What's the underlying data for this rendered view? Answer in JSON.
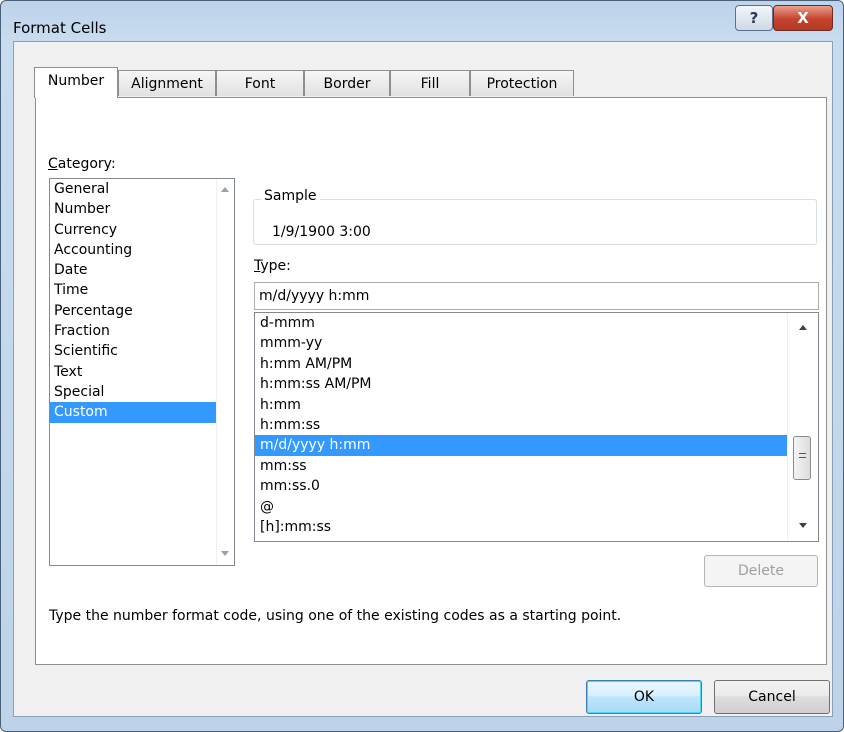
{
  "window": {
    "title": "Format Cells",
    "help_label": "?",
    "close_label": "X"
  },
  "tabs": [
    {
      "label": "Number",
      "active": true
    },
    {
      "label": "Alignment",
      "active": false
    },
    {
      "label": "Font",
      "active": false
    },
    {
      "label": "Border",
      "active": false
    },
    {
      "label": "Fill",
      "active": false
    },
    {
      "label": "Protection",
      "active": false
    }
  ],
  "category": {
    "label_first": "C",
    "label_rest": "ategory:",
    "items": [
      "General",
      "Number",
      "Currency",
      "Accounting",
      "Date",
      "Time",
      "Percentage",
      "Fraction",
      "Scientific",
      "Text",
      "Special",
      "Custom"
    ],
    "selected": "Custom"
  },
  "sample": {
    "label": "Sample",
    "value": "1/9/1900 3:00"
  },
  "type": {
    "label_first": "T",
    "label_rest": "ype:",
    "value": "m/d/yyyy h:mm",
    "items": [
      "d-mmm",
      "mmm-yy",
      "h:mm AM/PM",
      "h:mm:ss AM/PM",
      "h:mm",
      "h:mm:ss",
      "m/d/yyyy h:mm",
      "mm:ss",
      "mm:ss.0",
      "@",
      "[h]:mm:ss"
    ],
    "selected": "m/d/yyyy h:mm"
  },
  "buttons": {
    "delete": "Delete",
    "ok": "OK",
    "cancel": "Cancel"
  },
  "hint": "Type the number format code, using one of the existing codes as a starting point.",
  "colors": {
    "selection": "#3399ff",
    "title_bar": "#c9dcef",
    "close_button": "#c5432c"
  }
}
